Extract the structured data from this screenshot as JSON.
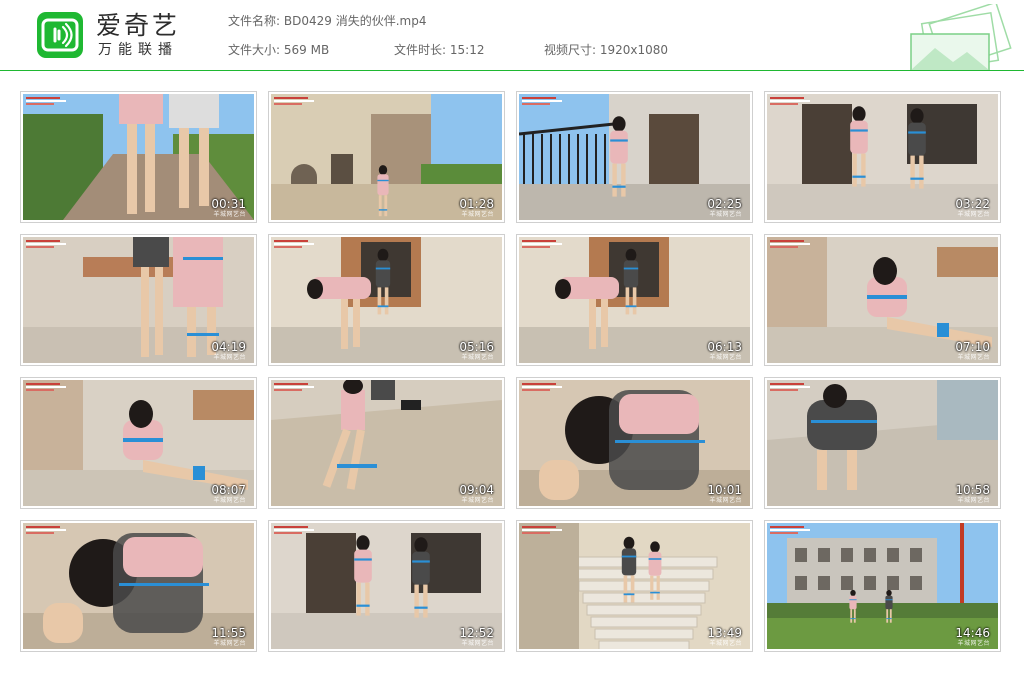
{
  "header": {
    "brand_title": "爱奇艺",
    "brand_subtitle": "万能联播",
    "file_name_label": "文件名称:",
    "file_name": "BD0429 消失的伙伴.mp4",
    "file_size_label": "文件大小:",
    "file_size": "569 MB",
    "duration_label": "文件时长:",
    "duration": "15:12",
    "resolution_label": "视频尺寸:",
    "resolution": "1920x1080"
  },
  "colors": {
    "accent": "#1fb832"
  },
  "thumbnails": [
    {
      "time": "00:31",
      "scene": "legs-outdoor"
    },
    {
      "time": "01:28",
      "scene": "villa-exterior"
    },
    {
      "time": "02:25",
      "scene": "balcony-door"
    },
    {
      "time": "03:22",
      "scene": "doorway-two"
    },
    {
      "time": "04:19",
      "scene": "legs-wall"
    },
    {
      "time": "05:16",
      "scene": "window-bend"
    },
    {
      "time": "06:13",
      "scene": "window-bend"
    },
    {
      "time": "07:10",
      "scene": "sitting-floor"
    },
    {
      "time": "08:07",
      "scene": "sitting-floor"
    },
    {
      "time": "09:04",
      "scene": "lying-floor"
    },
    {
      "time": "10:01",
      "scene": "closeup"
    },
    {
      "time": "10:58",
      "scene": "kneeling"
    },
    {
      "time": "11:55",
      "scene": "closeup"
    },
    {
      "time": "12:52",
      "scene": "doorway-two"
    },
    {
      "time": "13:49",
      "scene": "stairs"
    },
    {
      "time": "14:46",
      "scene": "buildings"
    }
  ],
  "watermark": "羊城网艺台"
}
